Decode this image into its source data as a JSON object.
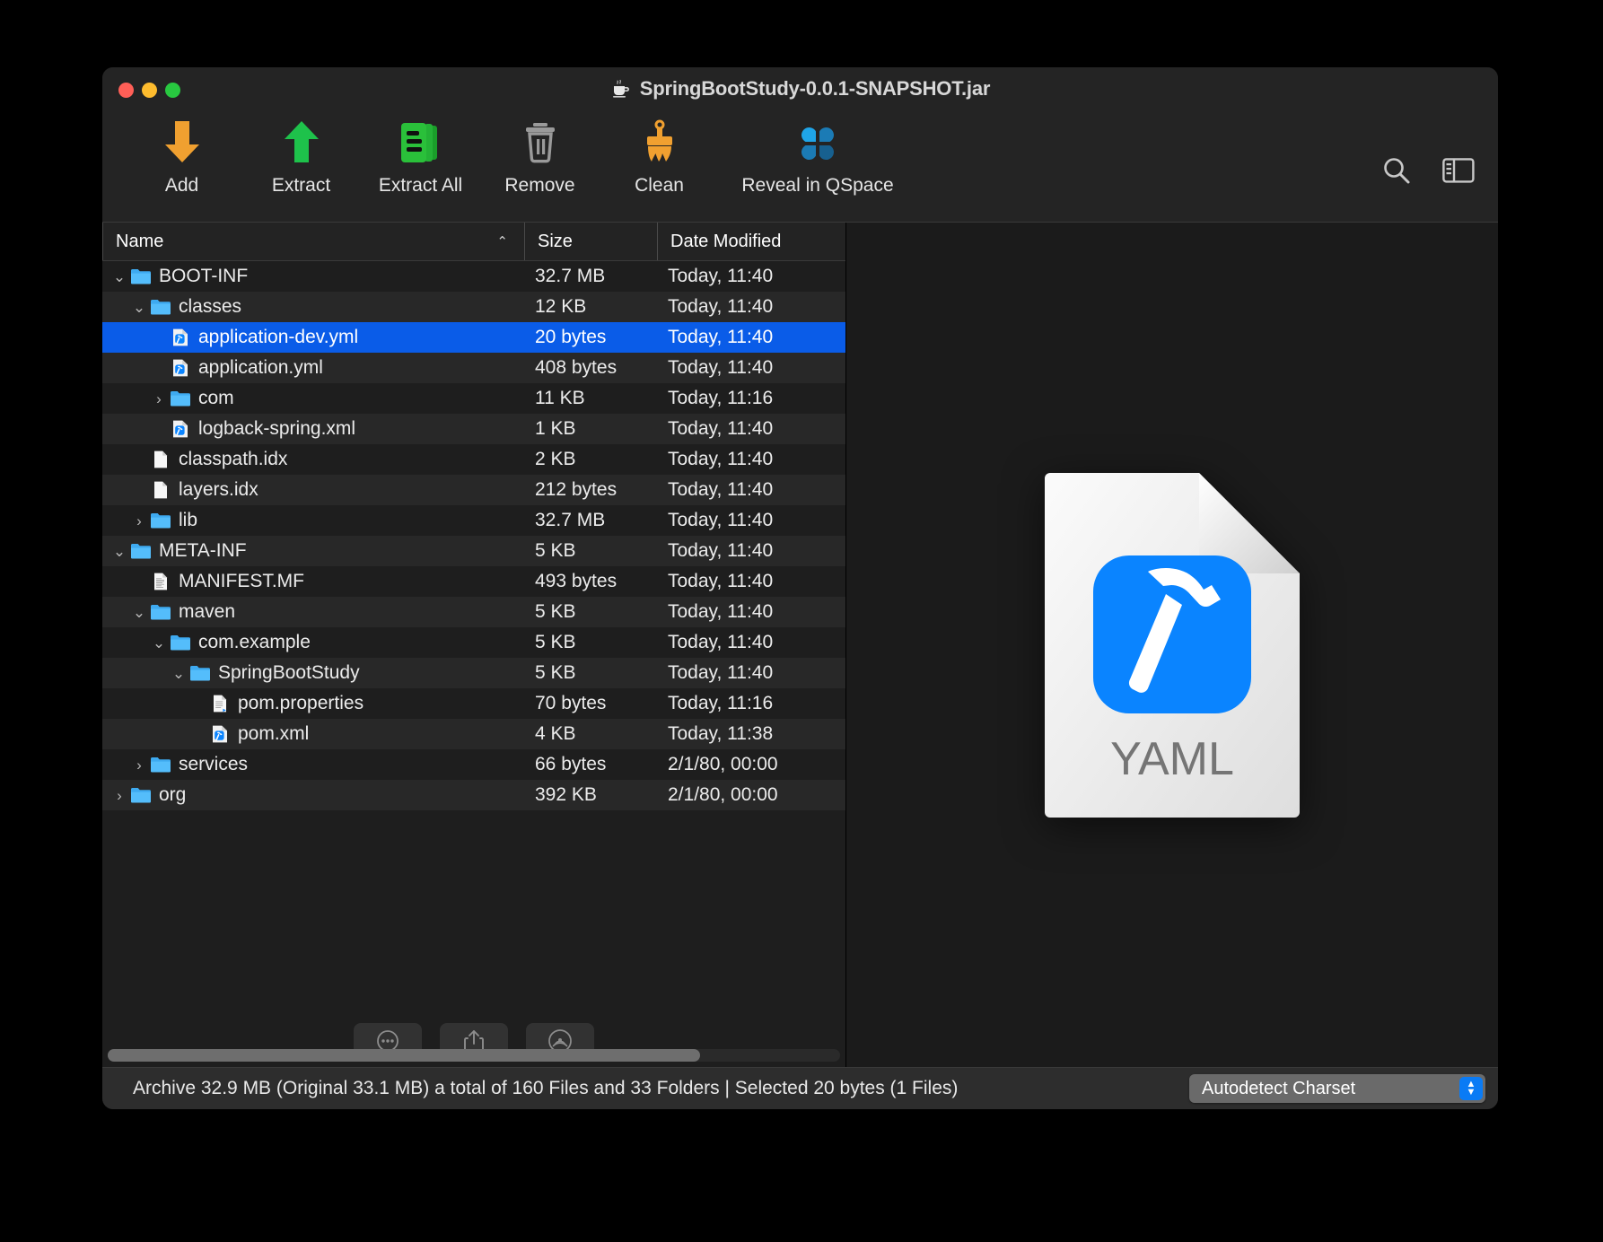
{
  "window": {
    "title": "SpringBootStudy-0.0.1-SNAPSHOT.jar",
    "title_icon": "java-coffee-cup-icon",
    "traffic_lights": [
      "close-button",
      "minimize-button",
      "zoom-button"
    ]
  },
  "toolbar": {
    "items": [
      {
        "label": "Add",
        "icon": "down-arrow-icon",
        "color": "#f0a030"
      },
      {
        "label": "Extract",
        "icon": "up-arrow-icon",
        "color": "#1ec24b"
      },
      {
        "label": "Extract All",
        "icon": "documents-stack-icon",
        "color": "#22b82f"
      },
      {
        "label": "Remove",
        "icon": "trash-icon",
        "color": "#9a9a9a"
      },
      {
        "label": "Clean",
        "icon": "broom-icon",
        "color": "#f0a030"
      },
      {
        "label": "Reveal in QSpace",
        "icon": "qspace-clover-icon",
        "color": "#1e8fd5"
      }
    ],
    "right_icons": [
      {
        "name": "search-icon"
      },
      {
        "name": "toggle-sidebar-icon"
      }
    ]
  },
  "columns": [
    {
      "key": "name",
      "label": "Name",
      "sort": "ascending",
      "sort_glyph": "⌃"
    },
    {
      "key": "size",
      "label": "Size"
    },
    {
      "key": "date",
      "label": "Date Modified"
    }
  ],
  "rows": [
    {
      "name": "BOOT-INF",
      "size": "32.7 MB",
      "date": "Today, 11:40",
      "indent": 0,
      "twisty": "⌄",
      "icon": "folder-icon",
      "selected": false
    },
    {
      "name": "classes",
      "size": "12 KB",
      "date": "Today, 11:40",
      "indent": 1,
      "twisty": "⌄",
      "icon": "folder-icon",
      "selected": false
    },
    {
      "name": "application-dev.yml",
      "size": "20 bytes",
      "date": "Today, 11:40",
      "indent": 2,
      "twisty": "",
      "icon": "yaml-file-icon",
      "selected": true
    },
    {
      "name": "application.yml",
      "size": "408 bytes",
      "date": "Today, 11:40",
      "indent": 2,
      "twisty": "",
      "icon": "yaml-file-icon",
      "selected": false
    },
    {
      "name": "com",
      "size": "11 KB",
      "date": "Today, 11:16",
      "indent": 2,
      "twisty": "›",
      "icon": "folder-icon",
      "selected": false
    },
    {
      "name": "logback-spring.xml",
      "size": "1 KB",
      "date": "Today, 11:40",
      "indent": 2,
      "twisty": "",
      "icon": "yaml-file-icon",
      "selected": false
    },
    {
      "name": "classpath.idx",
      "size": "2 KB",
      "date": "Today, 11:40",
      "indent": 1,
      "twisty": "",
      "icon": "blank-document-icon",
      "selected": false
    },
    {
      "name": "layers.idx",
      "size": "212 bytes",
      "date": "Today, 11:40",
      "indent": 1,
      "twisty": "",
      "icon": "blank-document-icon",
      "selected": false
    },
    {
      "name": "lib",
      "size": "32.7 MB",
      "date": "Today, 11:40",
      "indent": 1,
      "twisty": "›",
      "icon": "folder-icon",
      "selected": false
    },
    {
      "name": "META-INF",
      "size": "5 KB",
      "date": "Today, 11:40",
      "indent": 0,
      "twisty": "⌄",
      "icon": "folder-icon",
      "selected": false
    },
    {
      "name": "MANIFEST.MF",
      "size": "493 bytes",
      "date": "Today, 11:40",
      "indent": 1,
      "twisty": "",
      "icon": "text-document-icon",
      "selected": false
    },
    {
      "name": "maven",
      "size": "5 KB",
      "date": "Today, 11:40",
      "indent": 1,
      "twisty": "⌄",
      "icon": "folder-icon",
      "selected": false
    },
    {
      "name": "com.example",
      "size": "5 KB",
      "date": "Today, 11:40",
      "indent": 2,
      "twisty": "⌄",
      "icon": "folder-icon",
      "selected": false
    },
    {
      "name": "SpringBootStudy",
      "size": "5 KB",
      "date": "Today, 11:40",
      "indent": 3,
      "twisty": "⌄",
      "icon": "folder-icon",
      "selected": false
    },
    {
      "name": "pom.properties",
      "size": "70 bytes",
      "date": "Today, 11:16",
      "indent": 4,
      "twisty": "",
      "icon": "properties-file-icon",
      "selected": false
    },
    {
      "name": "pom.xml",
      "size": "4 KB",
      "date": "Today, 11:38",
      "indent": 4,
      "twisty": "",
      "icon": "yaml-file-icon",
      "selected": false
    },
    {
      "name": "services",
      "size": "66 bytes",
      "date": "2/1/80, 00:00",
      "indent": 1,
      "twisty": "›",
      "icon": "folder-icon",
      "selected": false
    },
    {
      "name": "org",
      "size": "392 KB",
      "date": "2/1/80, 00:00",
      "indent": 0,
      "twisty": "›",
      "icon": "folder-icon",
      "selected": false
    }
  ],
  "pane_bottom": {
    "buttons": [
      {
        "name": "more-options-button",
        "icon": "ellipsis-circle-icon"
      },
      {
        "name": "share-button",
        "icon": "share-up-arrow-icon"
      },
      {
        "name": "airdrop-button",
        "icon": "airdrop-icon"
      }
    ],
    "scrollbar": "horizontal-scrollbar"
  },
  "preview": {
    "file_type_label": "YAML",
    "icon": "yaml-document-large-icon",
    "badge_icon": "hammer-icon",
    "badge_color": "#0a84ff"
  },
  "statusbar": {
    "text": "Archive 32.9 MB (Original 33.1 MB) a total of 160 Files and 33 Folders  |  Selected 20 bytes (1 Files)",
    "charset": {
      "value": "Autodetect Charset",
      "stepper_up": "▲",
      "stepper_down": "▼",
      "accent": "#0a7bf5"
    }
  }
}
